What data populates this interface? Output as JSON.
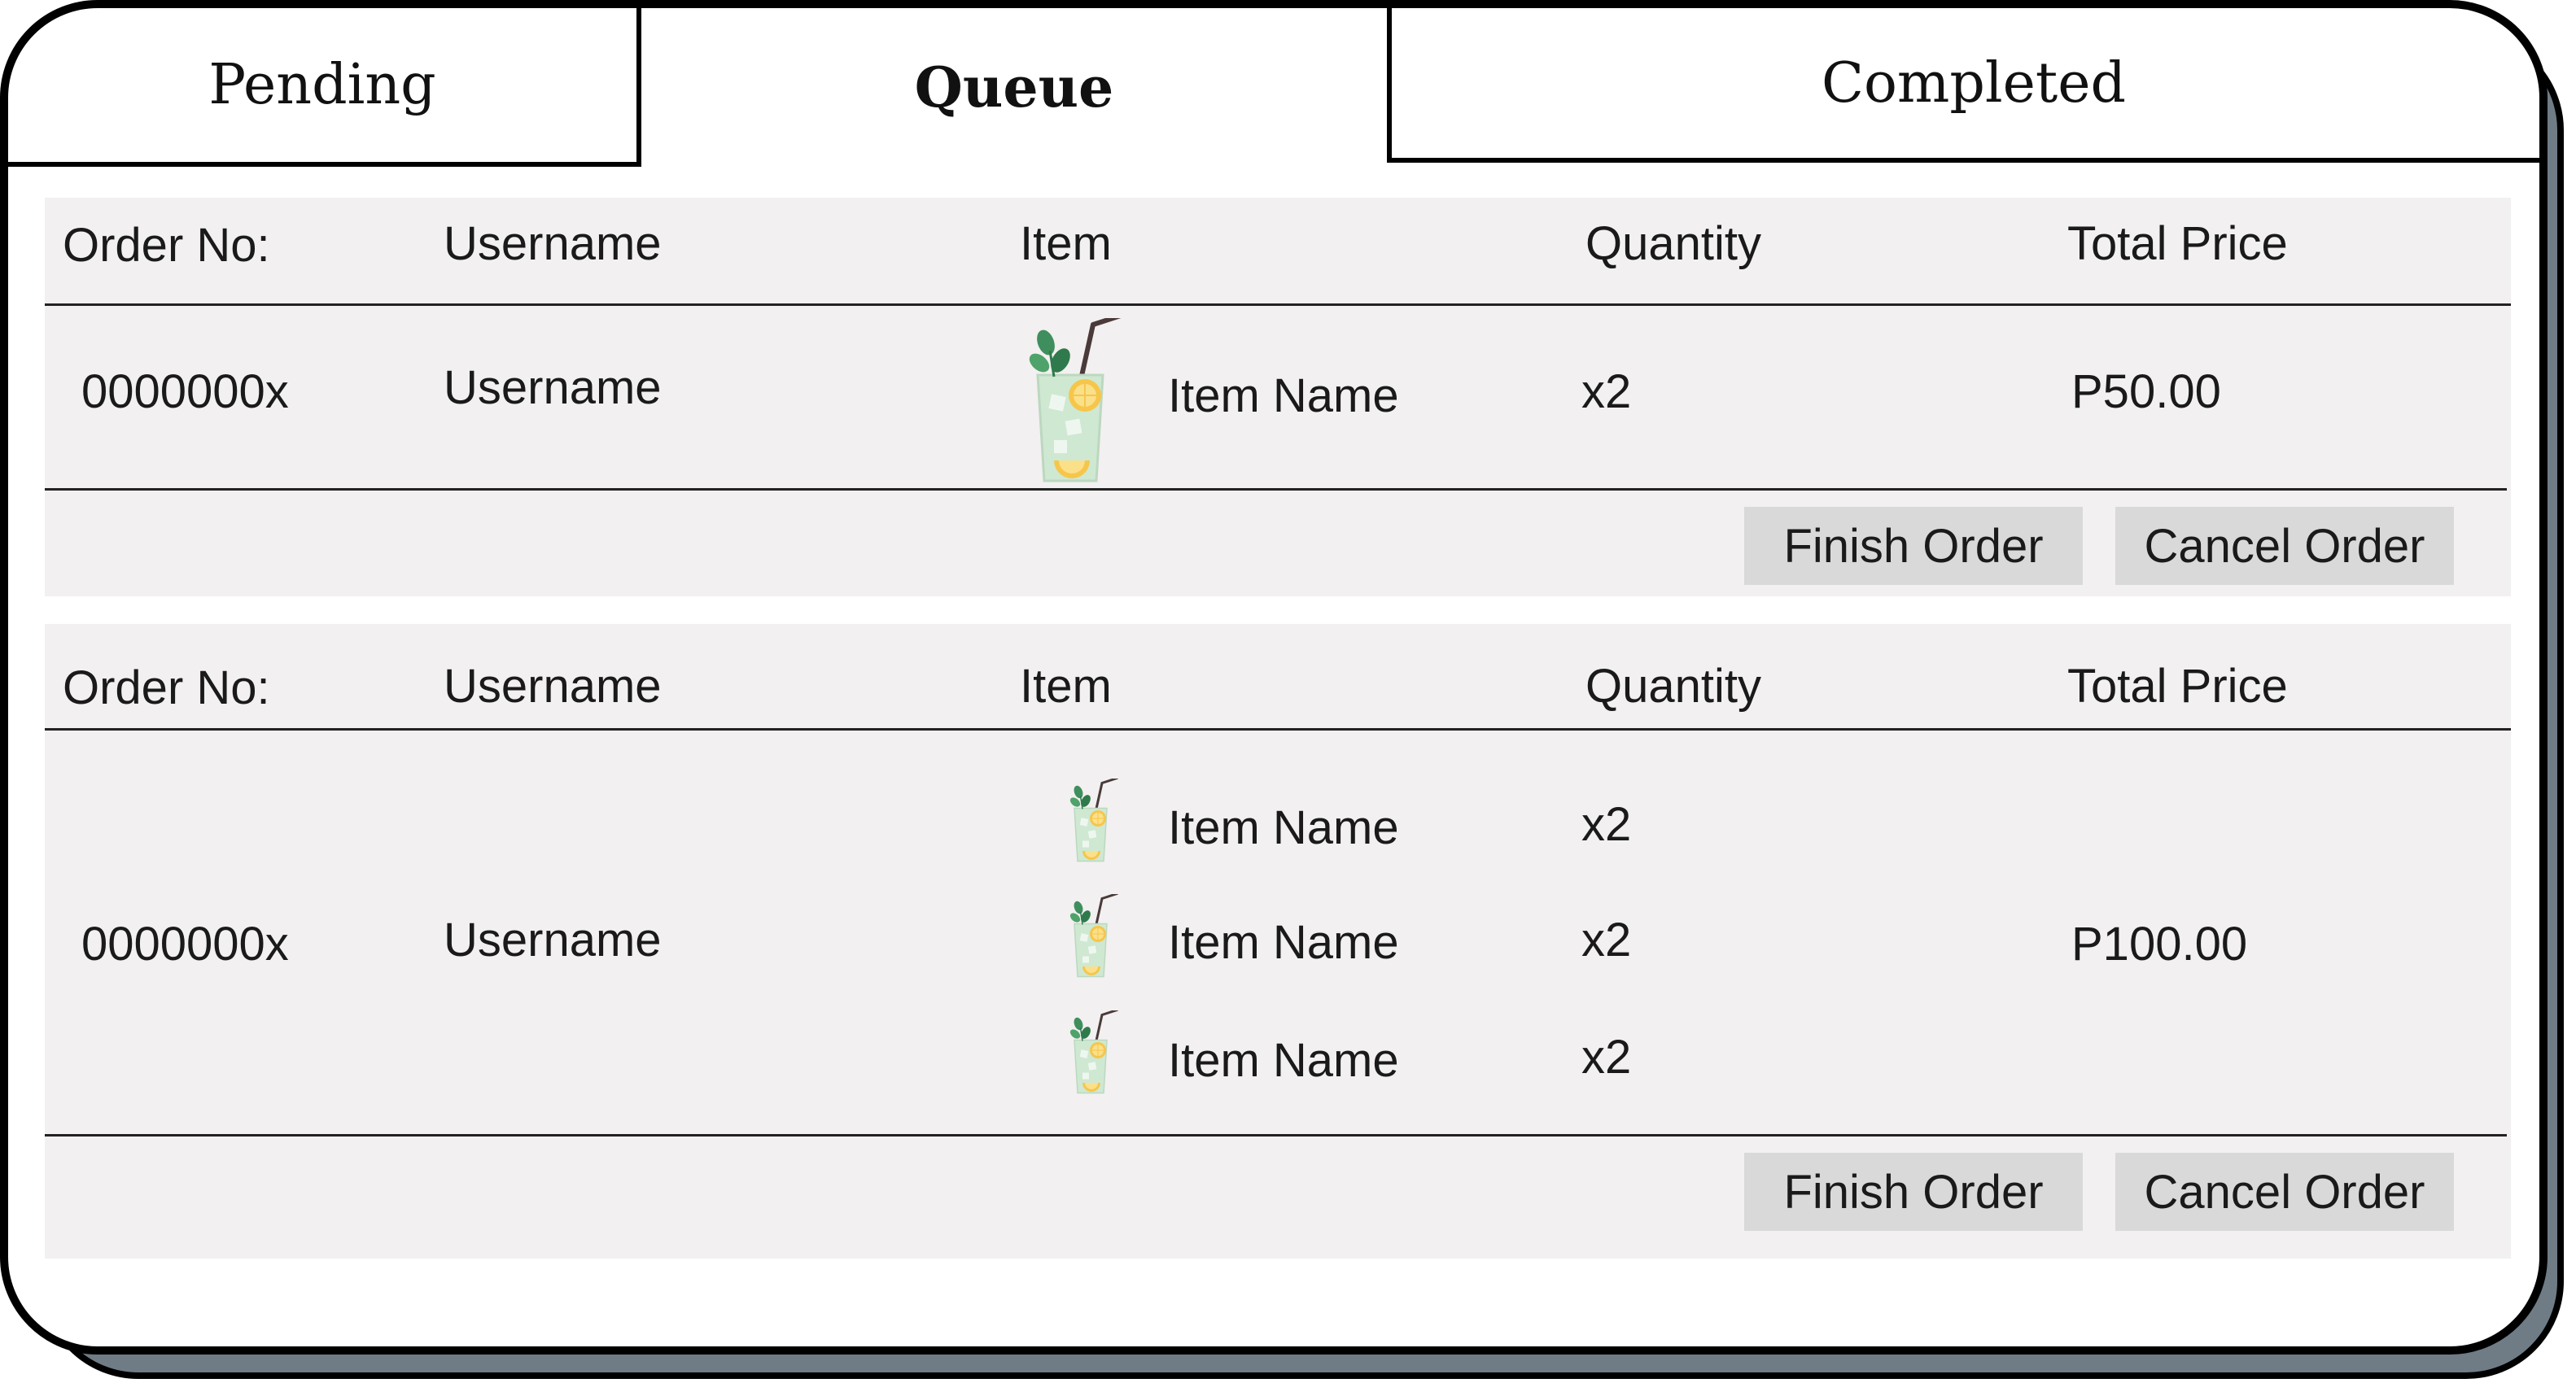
{
  "tabs": [
    {
      "label": "Pending"
    },
    {
      "label": "Queue"
    },
    {
      "label": "Completed"
    }
  ],
  "active_tab": "Queue",
  "columns": {
    "order_no": "Order No:",
    "username": "Username",
    "item": "Item",
    "quantity": "Quantity",
    "total_price": "Total Price"
  },
  "orders": [
    {
      "order_no": "0000000x",
      "username": "Username",
      "items": [
        {
          "name": "Item Name",
          "quantity": "x2",
          "icon": "mojito-drink-icon"
        }
      ],
      "total_price": "P50.00",
      "finish_label": "Finish Order",
      "cancel_label": "Cancel Order"
    },
    {
      "order_no": "0000000x",
      "username": "Username",
      "items": [
        {
          "name": "Item Name",
          "quantity": "x2",
          "icon": "mojito-drink-icon"
        },
        {
          "name": "Item Name",
          "quantity": "x2",
          "icon": "mojito-drink-icon"
        },
        {
          "name": "Item Name",
          "quantity": "x2",
          "icon": "mojito-drink-icon"
        }
      ],
      "total_price": "P100.00",
      "finish_label": "Finish Order",
      "cancel_label": "Cancel Order"
    }
  ],
  "colors": {
    "card_bg": "#f2f0f0",
    "button_bg": "#d9d9d9",
    "shadow": "#6f7c86"
  }
}
